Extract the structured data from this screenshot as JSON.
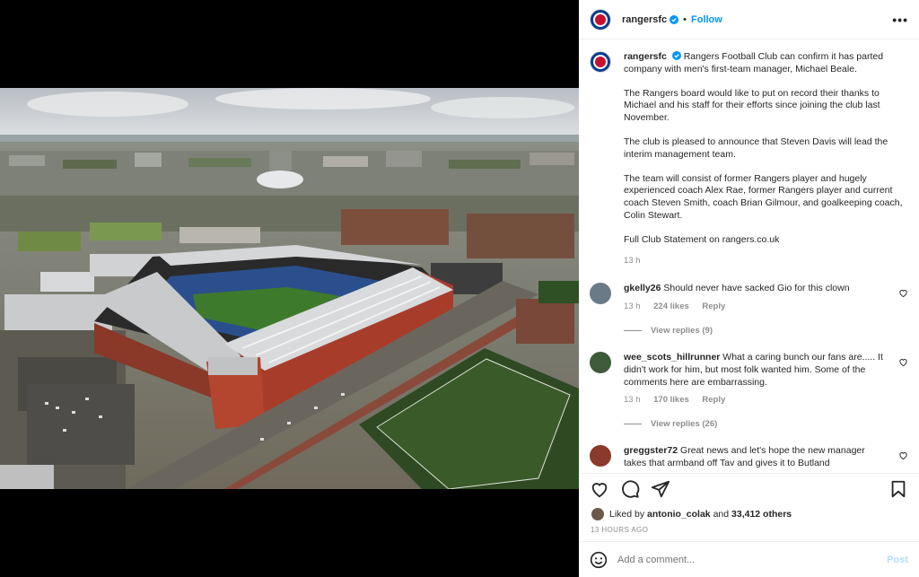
{
  "account": {
    "username": "rangersfc",
    "dot": "•",
    "follow_label": "Follow",
    "more_label": "•••"
  },
  "caption": {
    "username": "rangersfc",
    "paragraphs": [
      "Rangers Football Club can confirm it has parted company with men's first-team manager, Michael Beale.",
      "The Rangers board would like to put on record their thanks to Michael and his staff for their efforts since joining the club last November.",
      "The club is pleased to announce that Steven Davis will lead the interim management team.",
      "The team will consist of former Rangers player and hugely experienced coach Alex Rae, former Rangers player and current coach Steven Smith, coach Brian Gilmour, and goalkeeping coach, Colin Stewart.",
      "Full Club Statement on rangers.co.uk"
    ],
    "time": "13 h"
  },
  "comments": [
    {
      "username": "gkelly26",
      "text": "Should never have sacked Gio for this clown",
      "time": "13 h",
      "likes": "224 likes",
      "reply_label": "Reply",
      "view_replies": "View replies (9)",
      "avatar_color": "#6a7a86"
    },
    {
      "username": "wee_scots_hillrunner",
      "text": "What a caring bunch our fans are..... It didn't work for him, but most folk wanted him. Some of the comments here are embarrassing.",
      "time": "13 h",
      "likes": "170 likes",
      "reply_label": "Reply",
      "view_replies": "View replies (26)",
      "avatar_color": "#3f5a3a"
    },
    {
      "username": "greggster72",
      "text": "Great news and let's hope the new manager takes that armband off Tav and gives it to Butland",
      "avatar_color": "#8a3a2c"
    }
  ],
  "likes": {
    "prefix": "Liked by",
    "user": "antonio_colak",
    "joiner": "and",
    "others": "33,412 others"
  },
  "time_ago": "13 HOURS AGO",
  "comment_box": {
    "placeholder": "Add a comment...",
    "post_label": "Post"
  },
  "colors": {
    "accent": "#0095f6",
    "brand": "#0b3c8c",
    "post_disabled": "#b2dffc"
  },
  "icons": [
    "verified-badge-icon",
    "heart-icon",
    "comment-icon",
    "share-icon",
    "bookmark-icon",
    "emoji-icon",
    "more-options-icon"
  ]
}
